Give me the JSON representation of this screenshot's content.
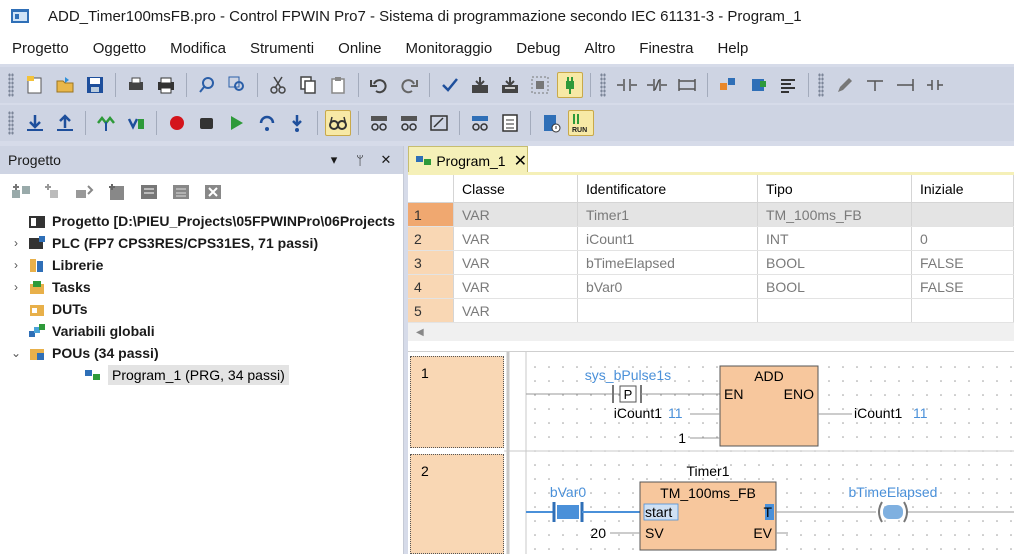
{
  "window": {
    "title": "ADD_Timer100msFB.pro - Control FPWIN Pro7 - Sistema di programmazione secondo IEC 61131-3 - Program_1"
  },
  "menu": [
    "Progetto",
    "Oggetto",
    "Modifica",
    "Strumenti",
    "Online",
    "Monitoraggio",
    "Debug",
    "Altro",
    "Finestra",
    "Help"
  ],
  "project_panel": {
    "title": "Progetto",
    "controls": [
      "▾",
      "ᛘ",
      "✕"
    ],
    "tree": [
      {
        "label": "Progetto [D:\\PIEU_Projects\\05FPWINPro\\06Projects",
        "chevron": "",
        "icon": "project-icon",
        "bold": true,
        "indent": 0
      },
      {
        "label": "PLC (FP7 CPS3RES/CPS31ES, 71 passi)",
        "chevron": "›",
        "icon": "plc-icon",
        "bold": true,
        "indent": 0
      },
      {
        "label": "Librerie",
        "chevron": "›",
        "icon": "library-icon",
        "bold": true,
        "indent": 0
      },
      {
        "label": "Tasks",
        "chevron": "›",
        "icon": "tasks-icon",
        "bold": true,
        "indent": 0
      },
      {
        "label": "DUTs",
        "chevron": "",
        "icon": "duts-icon",
        "bold": true,
        "indent": 0
      },
      {
        "label": "Variabili globali",
        "chevron": "",
        "icon": "global-vars-icon",
        "bold": true,
        "indent": 0
      },
      {
        "label": "POUs (34 passi)",
        "chevron": "⌄",
        "icon": "pous-icon",
        "bold": true,
        "indent": 0
      },
      {
        "label": "Program_1 (PRG, 34 passi)",
        "chevron": "",
        "icon": "program-icon",
        "bold": false,
        "indent": 1,
        "selected": true
      }
    ]
  },
  "editor": {
    "tab": {
      "label": "Program_1",
      "close": "✕"
    },
    "var_table": {
      "headers": [
        "",
        "Classe",
        "Identificatore",
        "Tipo",
        "Iniziale"
      ],
      "rows": [
        [
          "1",
          "VAR",
          "Timer1",
          "TM_100ms_FB",
          ""
        ],
        [
          "2",
          "VAR",
          "iCount1",
          "INT",
          "0"
        ],
        [
          "3",
          "VAR",
          "bTimeElapsed",
          "BOOL",
          "FALSE"
        ],
        [
          "4",
          "VAR",
          "bVar0",
          "BOOL",
          "FALSE"
        ],
        [
          "5",
          "VAR",
          "",
          "",
          ""
        ]
      ],
      "scroll_arrow": "◀"
    },
    "ladder": {
      "networks": [
        {
          "number": "1",
          "contact_var": "sys_bPulse1s",
          "contact_type": "P",
          "block_name": "ADD",
          "pin_en": "EN",
          "pin_eno": "ENO",
          "in1_var": "iCount1",
          "in1_value": "11",
          "in2_const": "1",
          "out_var": "iCount1",
          "out_value": "11"
        },
        {
          "number": "2",
          "instance": "Timer1",
          "block_name": "TM_100ms_FB",
          "contact_var": "bVar0",
          "pin_start": "start",
          "pin_t": "T",
          "pin_sv": "SV",
          "pin_ev": "EV",
          "sv_const": "20",
          "coil_var": "bTimeElapsed"
        }
      ]
    }
  },
  "colors": {
    "accent_blue": "#4a90d9",
    "row_num_bg": "#f9d7b4",
    "block_fill": "#f7c79d",
    "tab_yellow": "#f5f0b8"
  }
}
